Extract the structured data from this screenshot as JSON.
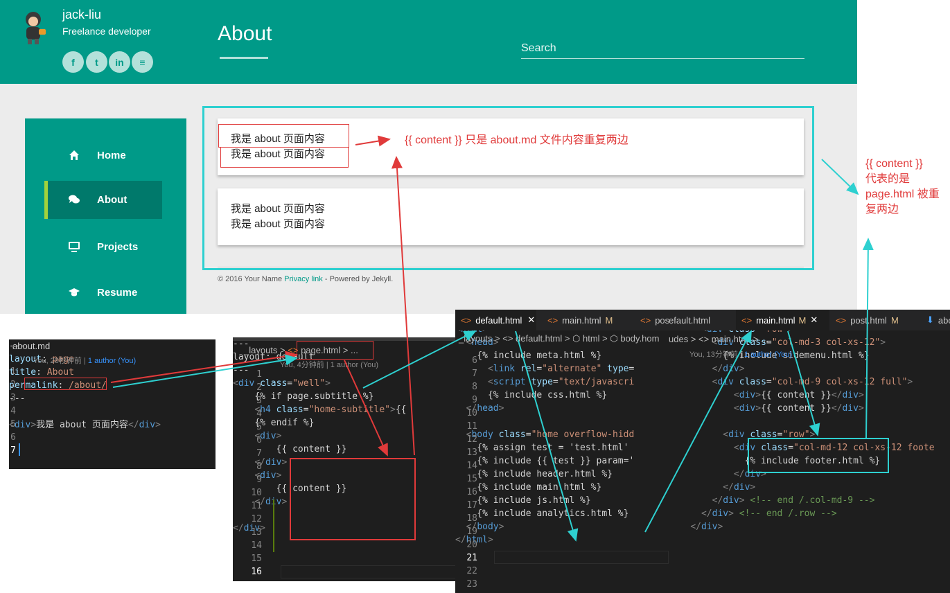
{
  "site": {
    "name": "jack-liu",
    "tagline": "Freelance developer",
    "social": [
      "f",
      "t",
      "in",
      "≡"
    ],
    "page_title": "About",
    "search_placeholder": "Search",
    "nav": [
      {
        "label": "Home",
        "icon": "home-icon"
      },
      {
        "label": "About",
        "icon": "comments-icon",
        "active": true
      },
      {
        "label": "Projects",
        "icon": "monitor-icon"
      },
      {
        "label": "Resume",
        "icon": "graduation-cap-icon"
      }
    ],
    "cards": [
      {
        "line1": "我是 about 页面内容",
        "line2": "我是 about 页面内容"
      },
      {
        "line1": "我是 about 页面内容",
        "line2": "我是 about 页面内容"
      }
    ],
    "footer": {
      "prefix": "© 2016 Your Name ",
      "link": "Privacy link",
      "suffix": " - Powered by Jekyll."
    }
  },
  "annotations": {
    "content_note": "{{ content }} 只是 about.md 文件内容重复两边",
    "page_note": [
      "{{  content }}",
      "代表的是",
      "page.html 被重",
      "复两边"
    ],
    "red_color": "#e03a3a",
    "cyan_color": "#2ed0d0"
  },
  "about_md": {
    "title": "about.md",
    "blame": "You, 28秒钟前 | ",
    "blame_link": "1 author (You)"
  },
  "page_html": {
    "crumb_dir": "_layouts",
    "crumb_file": "page.html",
    "crumb_tail": " > ...",
    "blame": "You, 4分钟前 | 1 author (You)"
  },
  "default_html": {
    "tabs": [
      {
        "label": "default.html",
        "active": true,
        "close": "✕"
      },
      {
        "label": "main.html",
        "mod": "M"
      },
      {
        "label": "pos"
      }
    ],
    "crumbs": "_layouts > <> default.html > ⬡ html > ⬡ body.hom"
  },
  "main_html": {
    "tabs": [
      {
        "label": "efault.html"
      },
      {
        "label": "main.html",
        "mod": "M",
        "active": true,
        "close": "✕"
      },
      {
        "label": "post.html",
        "mod": "M"
      },
      {
        "label": "abo"
      }
    ],
    "crumbs": "udes > <> main.html > ...",
    "blame": "You, 13分钟前 | ",
    "blame_link": "1 author (You)"
  }
}
